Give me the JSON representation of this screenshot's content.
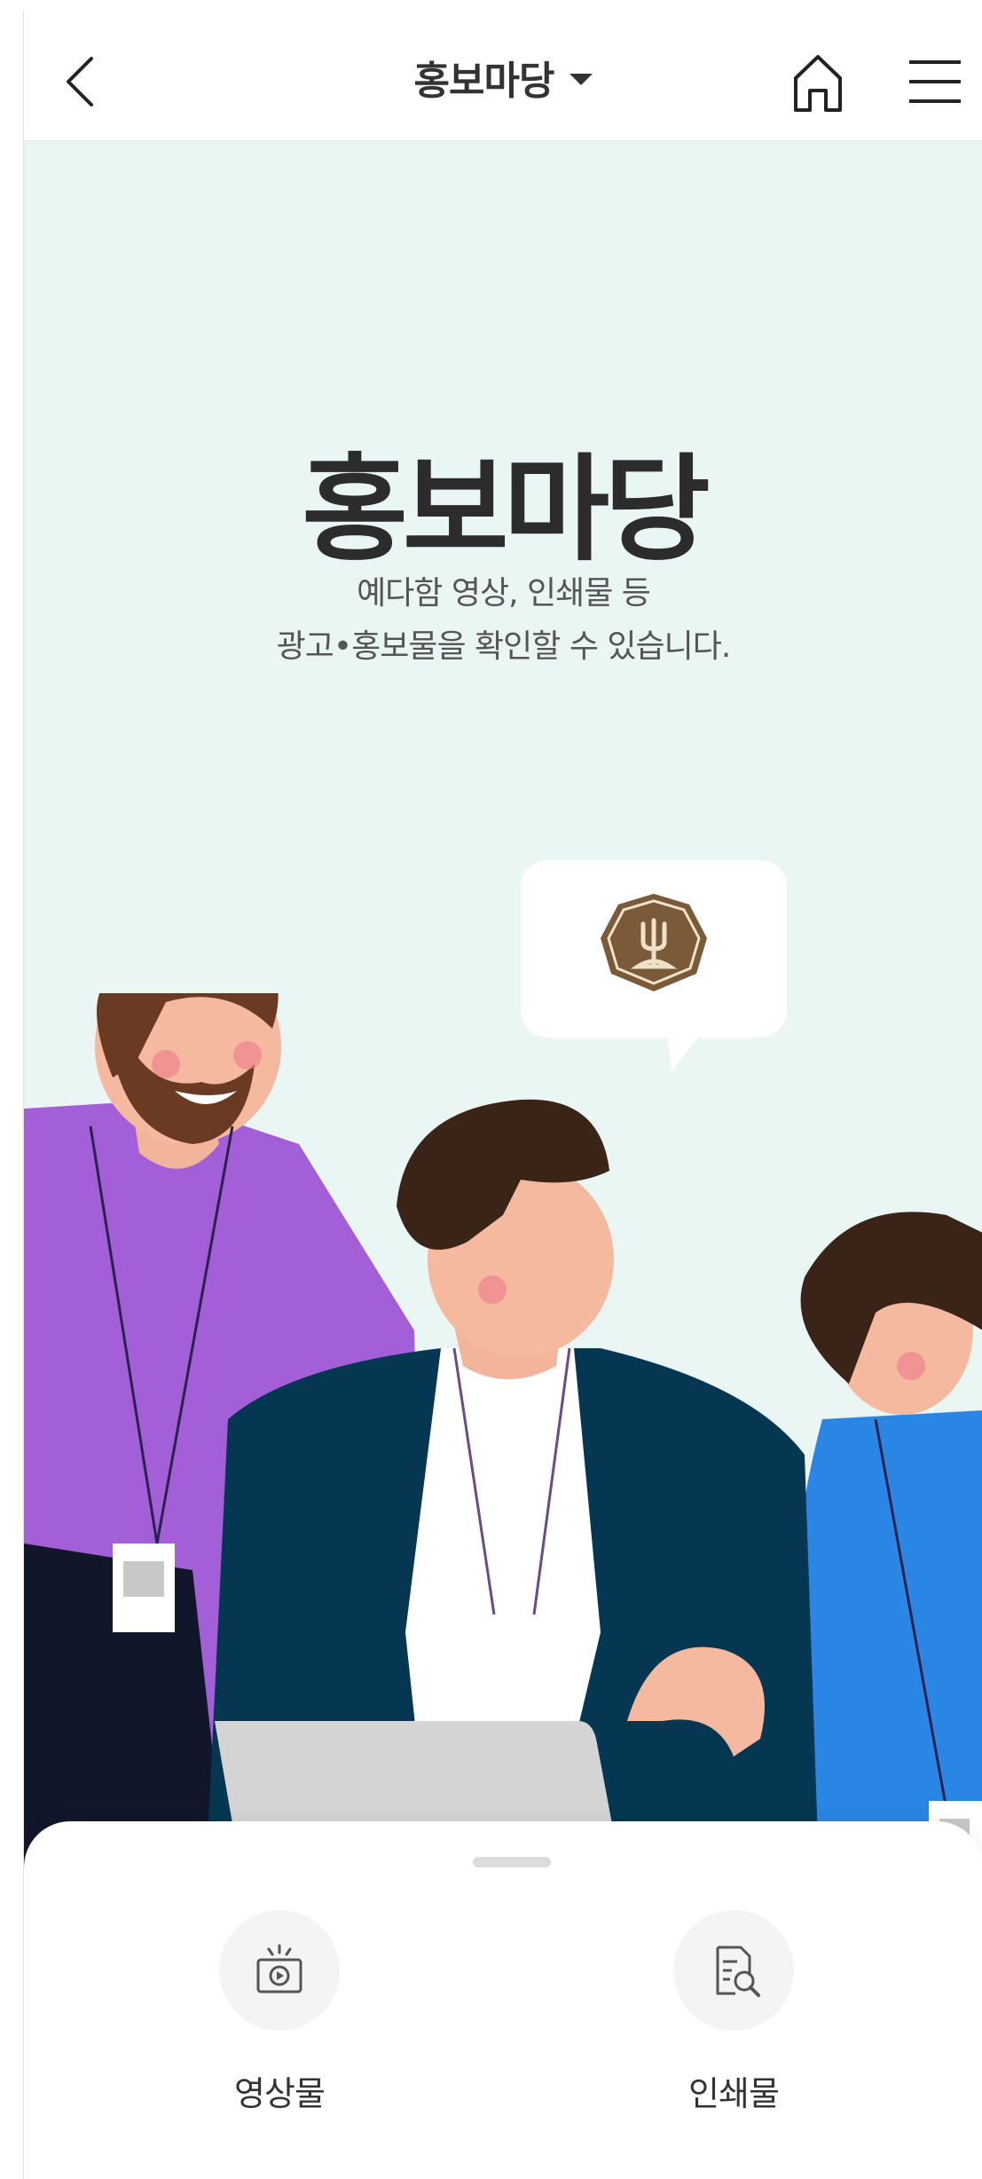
{
  "header": {
    "title": "홍보마당"
  },
  "hero": {
    "title": "홍보마당",
    "desc_line1": "예다함 영상, 인쇄물 등",
    "desc_line2": "광고•홍보물을 확인할 수 있습니다."
  },
  "categories": [
    {
      "label": "영상물",
      "icon": "video-icon"
    },
    {
      "label": "인쇄물",
      "icon": "print-search-icon"
    }
  ],
  "colors": {
    "background": "#eaf6f4",
    "brand_brown": "#7a5a38",
    "purple_shirt": "#a35fd8",
    "navy_jacket": "#053752",
    "blue_shirt": "#2a86e4"
  }
}
